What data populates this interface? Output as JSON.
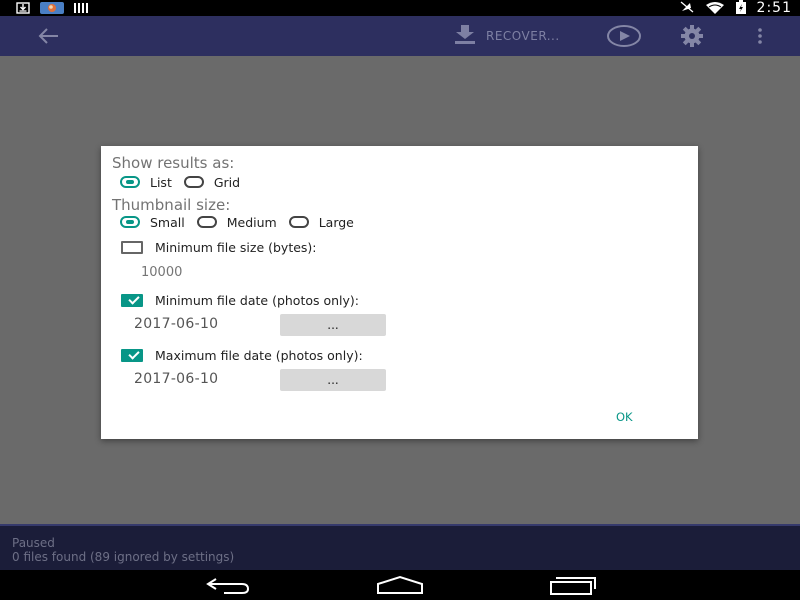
{
  "status_bar": {
    "time": "2:51",
    "left_icons": [
      "download-icon",
      "app-thumbnail-icon",
      "signal-bars-icon"
    ],
    "right_icons": [
      "no-sim-icon",
      "wifi-icon",
      "battery-charging-icon"
    ]
  },
  "app_bar": {
    "back_icon": "arrow-left-icon",
    "recover_label": "RECOVER...",
    "recover_icon": "download-icon",
    "play_icon": "play-circle-icon",
    "settings_icon": "gear-icon",
    "more_icon": "more-vertical-icon"
  },
  "dialog": {
    "show_results": {
      "heading": "Show results as:",
      "options": [
        {
          "label": "List",
          "selected": true
        },
        {
          "label": "Grid",
          "selected": false
        }
      ]
    },
    "thumbnail_size": {
      "heading": "Thumbnail size:",
      "options": [
        {
          "label": "Small",
          "selected": true
        },
        {
          "label": "Medium",
          "selected": false
        },
        {
          "label": "Large",
          "selected": false
        }
      ]
    },
    "min_file_size": {
      "label": "Minimum file size (bytes):",
      "checked": false,
      "placeholder": "10000"
    },
    "min_file_date": {
      "label": "Minimum file date (photos only):",
      "checked": true,
      "date": "2017-06-10",
      "button_label": "..."
    },
    "max_file_date": {
      "label": "Maximum file date (photos only):",
      "checked": true,
      "date": "2017-06-10",
      "button_label": "..."
    },
    "ok_label": "OK"
  },
  "footer": {
    "status": "Paused",
    "count_text": "0 files found (89 ignored by settings)"
  },
  "nav_bar": {
    "icons": [
      "nav-back-icon",
      "nav-home-icon",
      "nav-recents-icon"
    ]
  },
  "colors": {
    "accent": "#089687",
    "app_bar": "#2d2f5f",
    "footer": "#1b1d39",
    "scrim": "#6a6a6a"
  }
}
